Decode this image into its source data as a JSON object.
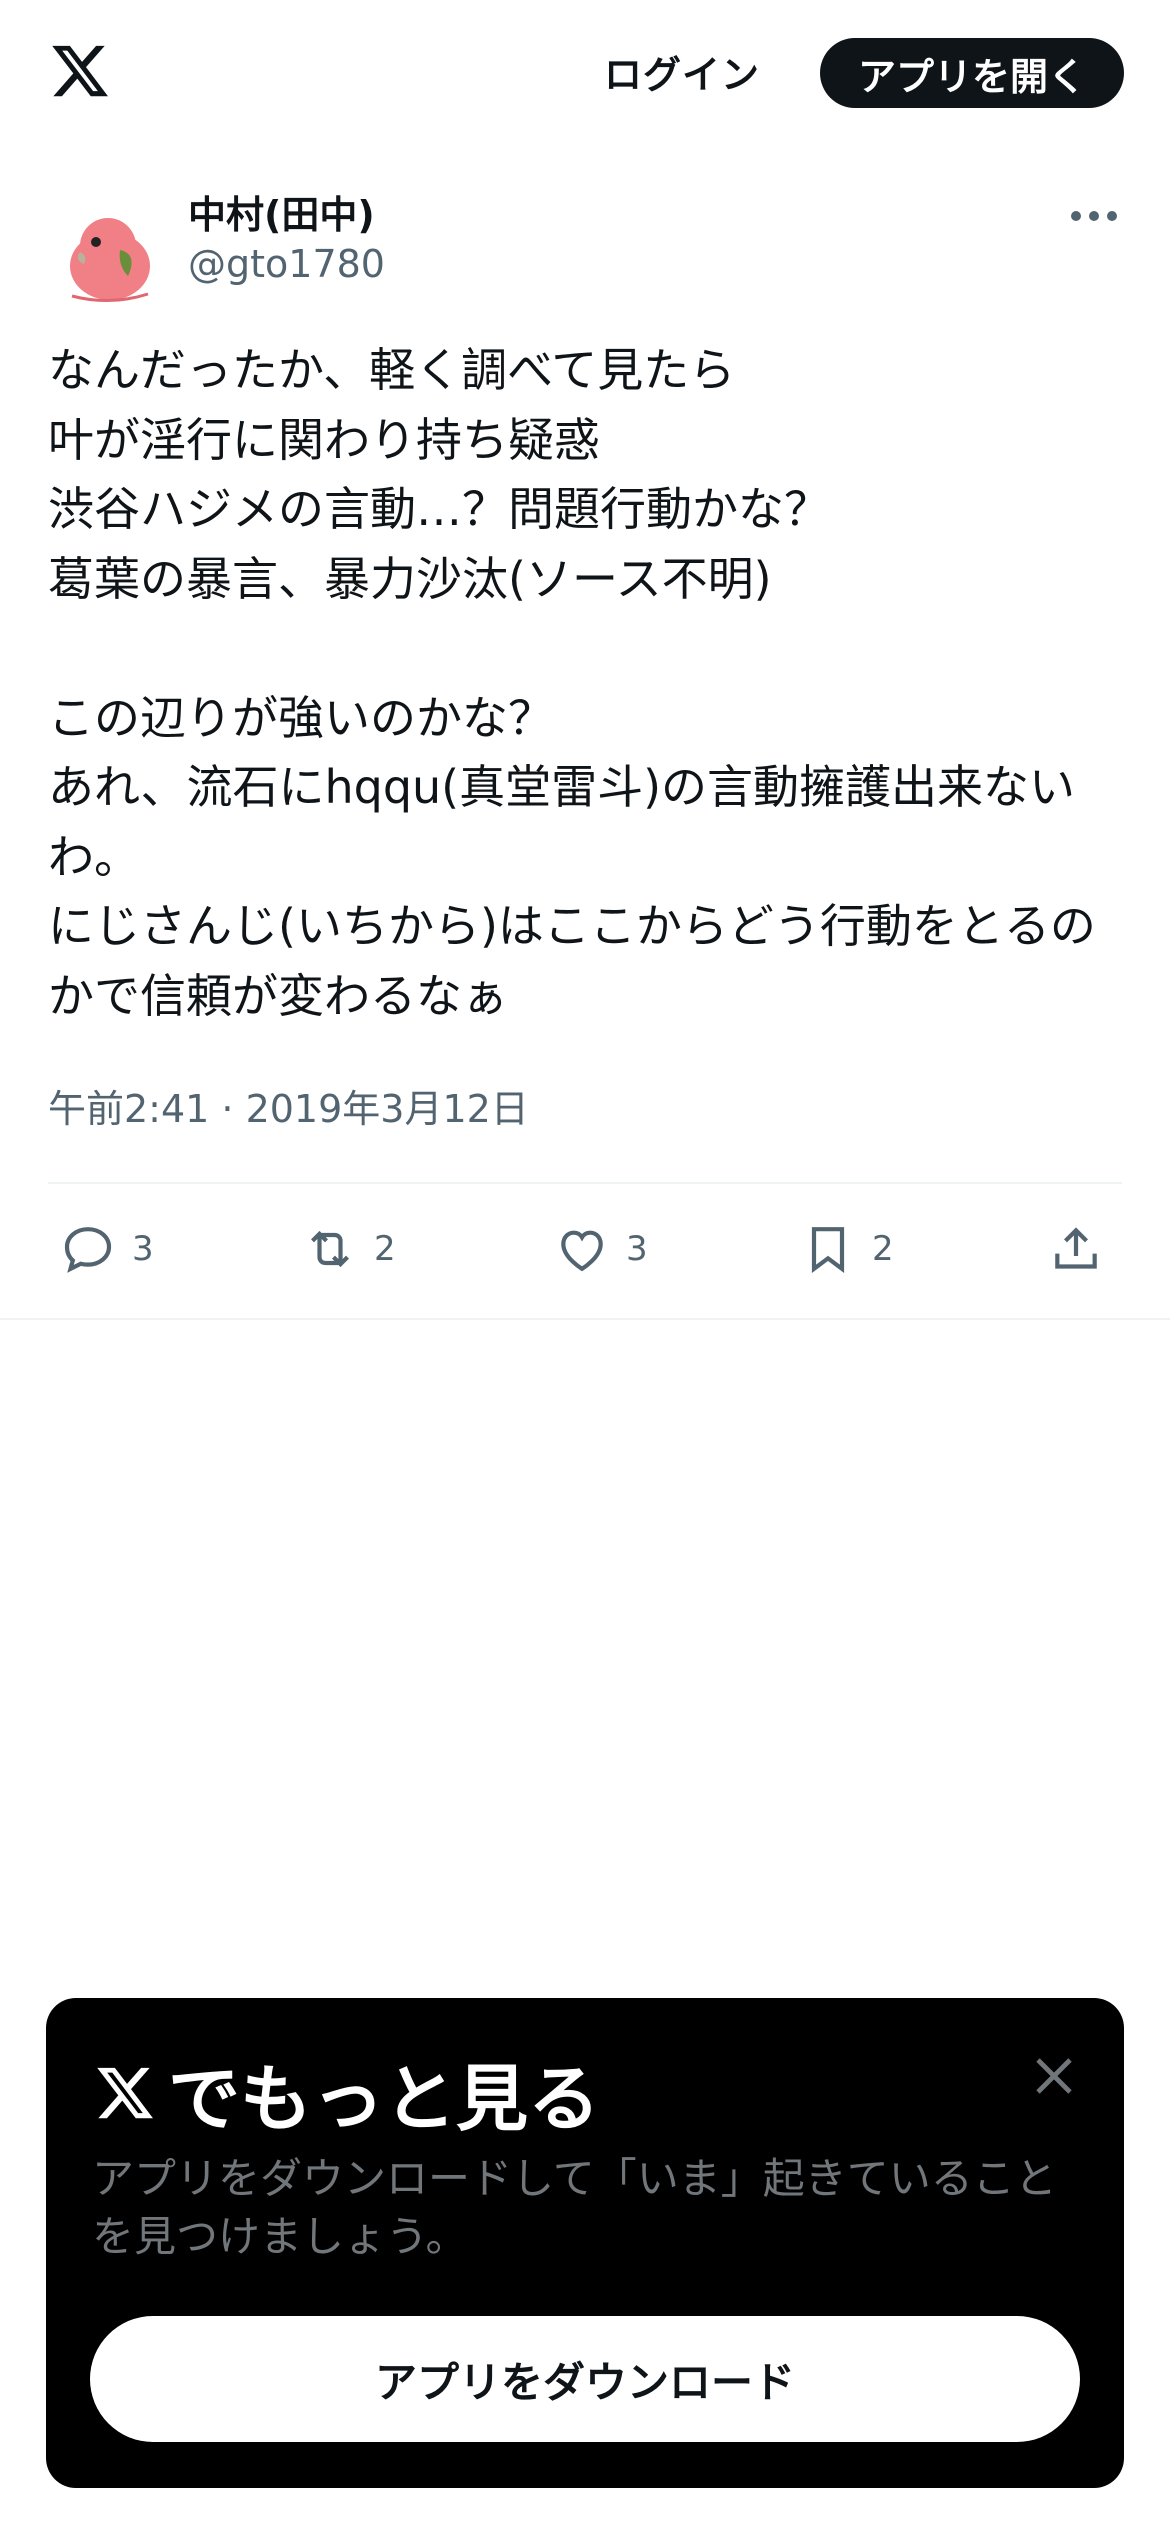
{
  "header": {
    "logo_icon": "x-logo-icon",
    "login_label": "ログイン",
    "open_app_label": "アプリを開く"
  },
  "tweet": {
    "author_name": "中村(田中)",
    "author_handle": "@gto1780",
    "text": "なんだったか、軽く調べて見たら\n叶が淫行に関わり持ち疑惑\n渋谷ハジメの言動…？問題行動かな？\n葛葉の暴言、暴力沙汰(ソース不明)\n\nこの辺りが強いのかな？\nあれ、流石にhqqu(真堂雷斗)の言動擁護出来ないわ。\nにじさんじ(いちから)はここからどう行動をとるのかで信頼が変わるなぁ",
    "timestamp": "午前2:41 · 2019年3月12日"
  },
  "actions": {
    "replies": "3",
    "retweets": "2",
    "likes": "3",
    "bookmarks": "2"
  },
  "popup": {
    "title": "でもっと見る",
    "description": "アプリをダウンロードして「いま」起きていることを見つけましょう。",
    "download_label": "アプリをダウンロード"
  },
  "colors": {
    "text_primary": "#0f1419",
    "text_secondary": "#536471",
    "popup_bg": "#000000",
    "avatar_bird": "#f07f86"
  }
}
